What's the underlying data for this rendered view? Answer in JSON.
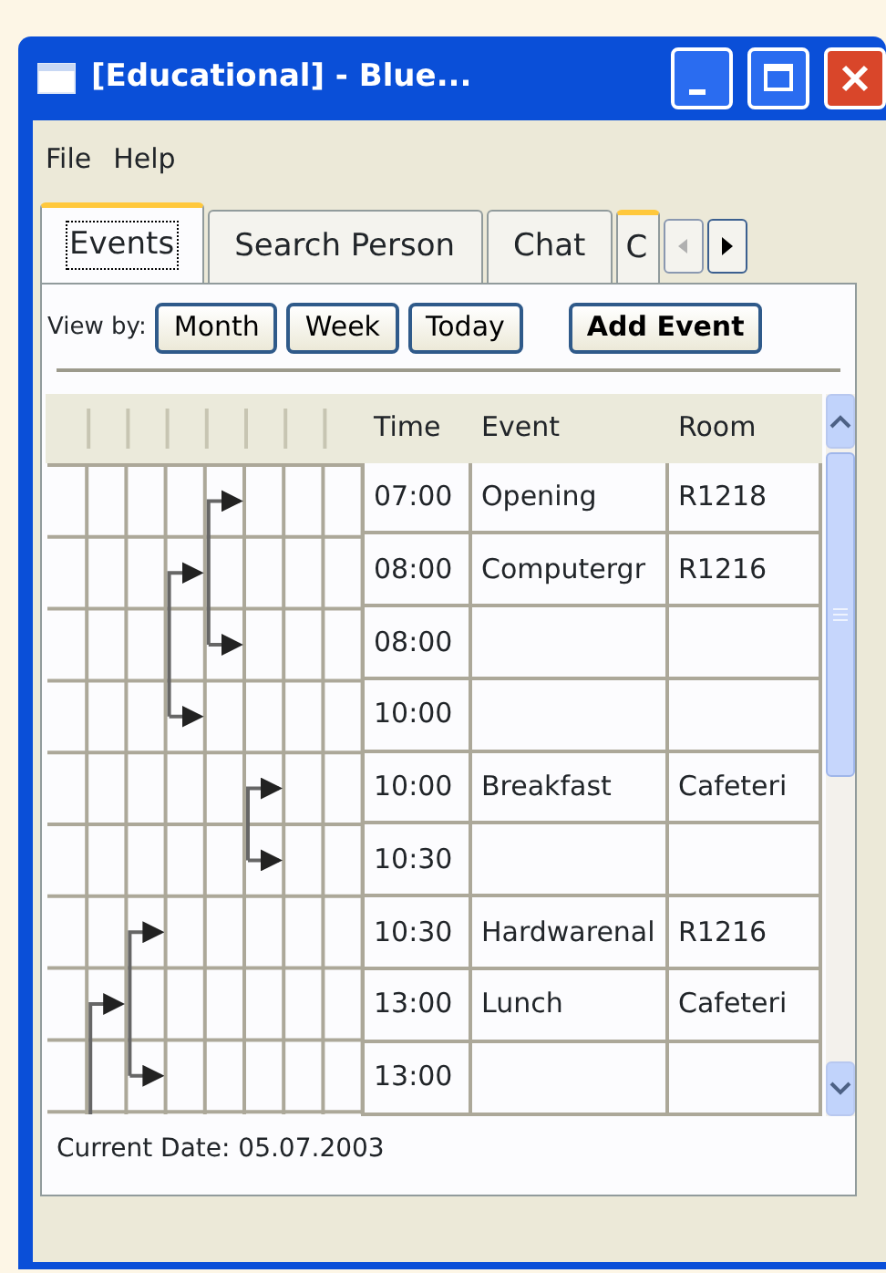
{
  "window": {
    "title": "[Educational] - Blue..."
  },
  "menu": [
    "File",
    "Help"
  ],
  "tabs": [
    {
      "label": "Events",
      "selected": true,
      "highlighted": true
    },
    {
      "label": "Search Person",
      "selected": false,
      "highlighted": false
    },
    {
      "label": "Chat",
      "selected": false,
      "highlighted": false
    },
    {
      "label": "C",
      "selected": false,
      "highlighted": true
    }
  ],
  "toolbar": {
    "label": "View by:",
    "buttons": [
      {
        "label": "Month",
        "kind": "plain"
      },
      {
        "label": "Week",
        "kind": "plain"
      },
      {
        "label": "Today",
        "kind": "plain"
      },
      {
        "label": "Add Event",
        "kind": "bold"
      }
    ]
  },
  "table": {
    "columns": [
      "Time",
      "Event",
      "Room"
    ],
    "rows": [
      {
        "time": "07:00",
        "event": "Opening",
        "room": "R1218"
      },
      {
        "time": "08:00",
        "event": "Computergr",
        "room": "R1216"
      },
      {
        "time": "08:00"
      },
      {
        "time": "10:00"
      },
      {
        "time": "10:00",
        "event": "Breakfast",
        "room": "Cafeteri"
      },
      {
        "time": "10:30"
      },
      {
        "time": "10:30",
        "event": "Hardwarenal",
        "room": "R1216"
      },
      {
        "time": "13:00",
        "event": "Lunch",
        "room": "Cafeteri"
      },
      {
        "time": "13:00"
      }
    ]
  },
  "status_bar": "Current Date: 05.07.2003"
}
